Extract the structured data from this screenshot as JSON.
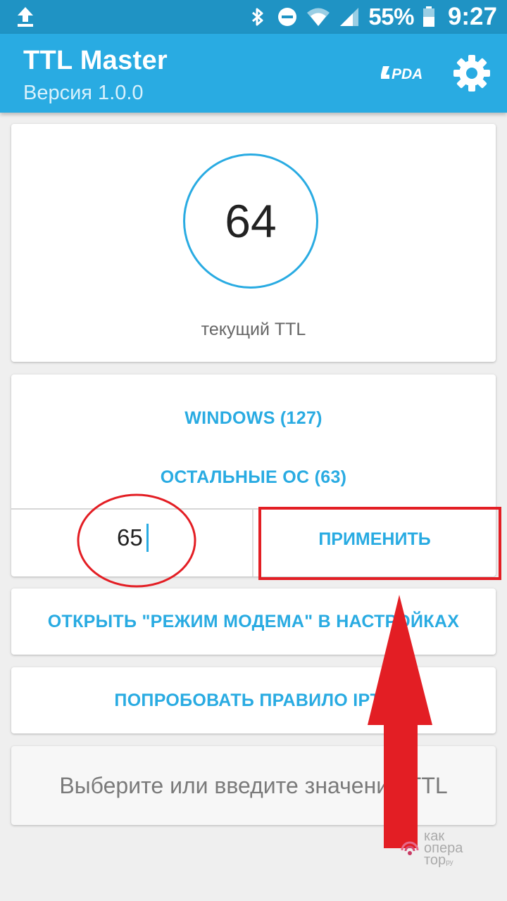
{
  "status_bar": {
    "battery_percent": "55%",
    "time": "9:27",
    "icons": [
      "upload-icon",
      "bluetooth-icon",
      "do-not-disturb-icon",
      "wifi-icon",
      "signal-icon",
      "battery-icon"
    ]
  },
  "app_bar": {
    "title": "TTL Master",
    "subtitle": "Версия 1.0.0",
    "logo": "4PDA"
  },
  "ttl_display": {
    "value": "64",
    "label": "текущий TTL"
  },
  "presets": {
    "windows_label": "WINDOWS (127)",
    "other_label": "ОСТАЛЬНЫЕ ОС (63)"
  },
  "ttl_input": {
    "value": "65"
  },
  "apply_label": "ПРИМЕНИТЬ",
  "modem_label": "ОТКРЫТЬ \"РЕЖИМ МОДЕМА\" В НАСТРОЙКАХ",
  "iptables_label": "ПОПРОБОВАТЬ ПРАВИЛО IPTA",
  "hint": "Выберите или введите значение TTL",
  "watermark": {
    "line1": "как",
    "line2": "опера",
    "line3": "тор",
    "suffix": "ру"
  },
  "colors": {
    "status_bar": "#1f93c4",
    "app_bar": "#29abe2",
    "accent": "#29abe2",
    "annotation": "#e31e24"
  }
}
